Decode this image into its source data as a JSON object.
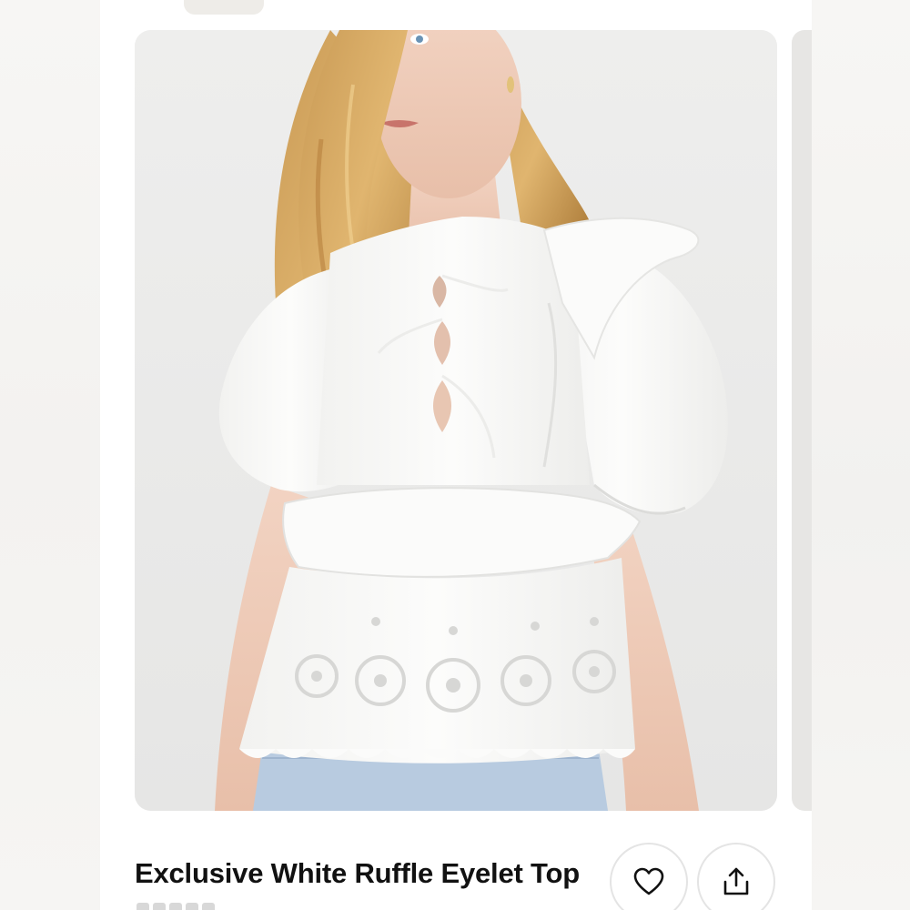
{
  "product": {
    "title": "Exclusive White Ruffle Eyelet Top",
    "image_alt": "Model wearing white ruffle eyelet top with puff sleeves and front ties"
  },
  "actions": {
    "favorite_icon": "heart-icon",
    "share_icon": "share-upload-icon"
  },
  "colors": {
    "background": "#ffffff",
    "image_bg": "#ecebea",
    "text": "#111111",
    "button_border": "#e4e4e4"
  }
}
